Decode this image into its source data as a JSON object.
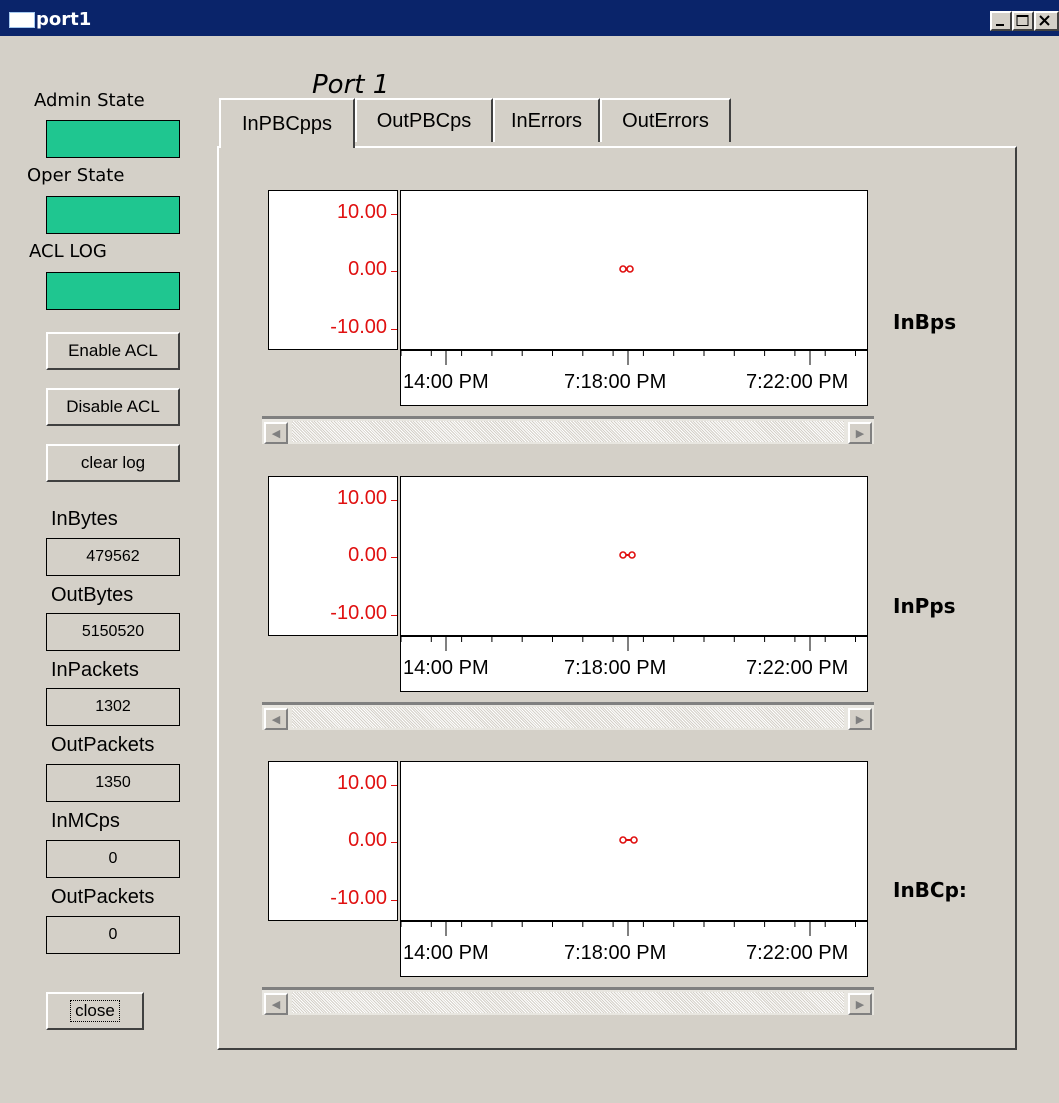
{
  "window": {
    "title": "port1"
  },
  "left_panel": {
    "admin_state_label": "Admin State",
    "oper_state_label": "Oper State",
    "acl_log_label": "ACL LOG",
    "state_color": "#1fc690",
    "enable_acl": "Enable ACL",
    "disable_acl": "Disable ACL",
    "clear_log": "clear log",
    "counters": [
      {
        "label": "InBytes",
        "value": "479562"
      },
      {
        "label": "OutBytes",
        "value": "5150520"
      },
      {
        "label": "InPackets",
        "value": "1302"
      },
      {
        "label": "OutPackets",
        "value": "1350"
      },
      {
        "label": "InMCps",
        "value": "0"
      },
      {
        "label": "OutPackets",
        "value": "0"
      }
    ],
    "close": "close"
  },
  "port_title": "Port 1",
  "tabs": [
    {
      "label": "InPBCpps",
      "active": true
    },
    {
      "label": "OutPBCps",
      "active": false
    },
    {
      "label": "InErrors",
      "active": false
    },
    {
      "label": "OutErrors",
      "active": false
    }
  ],
  "charts": [
    {
      "name": "InBps",
      "yticks": [
        "10.00",
        "0.00",
        "-10.00"
      ],
      "xticks": [
        "14:00 PM",
        "7:18:00 PM",
        "7:22:00 PM"
      ]
    },
    {
      "name": "InPps",
      "yticks": [
        "10.00",
        "0.00",
        "-10.00"
      ],
      "xticks": [
        "14:00 PM",
        "7:18:00 PM",
        "7:22:00 PM"
      ]
    },
    {
      "name": "InBCp:",
      "yticks": [
        "10.00",
        "0.00",
        "-10.00"
      ],
      "xticks": [
        "14:00 PM",
        "7:18:00 PM",
        "7:22:00 PM"
      ]
    }
  ],
  "colors": {
    "axis_text": "#e01010",
    "series": "#e01010"
  }
}
